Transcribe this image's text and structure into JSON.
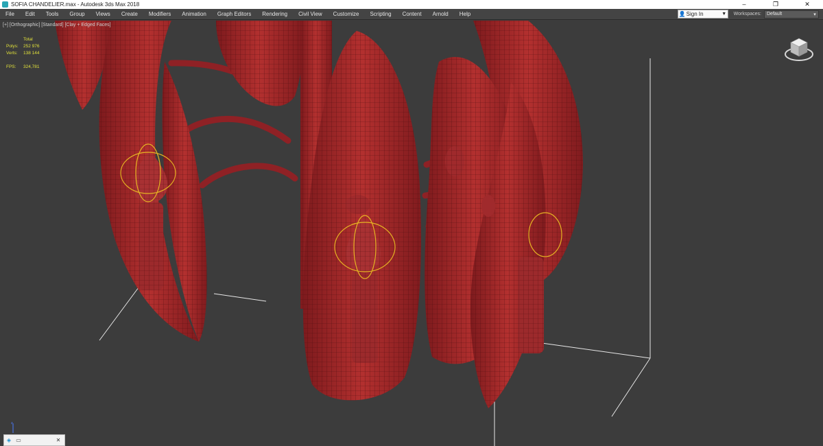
{
  "window": {
    "title": "SOFIA CHANDELIER.max - Autodesk 3ds Max 2018",
    "minimize": "–",
    "maximize": "❐",
    "close": "✕"
  },
  "menu": {
    "items": [
      "File",
      "Edit",
      "Tools",
      "Group",
      "Views",
      "Create",
      "Modifiers",
      "Animation",
      "Graph Editors",
      "Rendering",
      "Civil View",
      "Customize",
      "Scripting",
      "Content",
      "Arnold",
      "Help"
    ],
    "sign_in": "Sign In",
    "workspaces_label": "Workspaces:",
    "workspaces_value": "Default"
  },
  "viewport": {
    "label": "[+] [Orthographic] [Standard] [Clay + Edged Faces]",
    "stats": {
      "total": "Total",
      "polys_label": "Polys:",
      "polys_value": "252 976",
      "verts_label": "Verts:",
      "verts_value": "138 144",
      "fps_label": "FPS:",
      "fps_value": "324,781"
    }
  },
  "colors": {
    "background": "#3c3c3c",
    "model_clay": "#a3262a",
    "wire": "#4a0d0f",
    "selection_gizmo": "#e6b422",
    "stats_text": "#e1e13a",
    "menu_bg": "#444444"
  },
  "icons": {
    "app": "3ds-max-app-icon",
    "viewcube": "viewcube-icon",
    "user": "user-icon"
  }
}
